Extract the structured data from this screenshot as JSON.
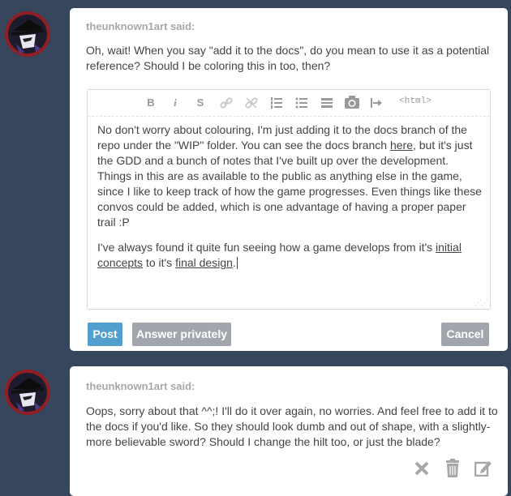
{
  "messages": [
    {
      "author": "theunknown1art said:",
      "text": "Oh, wait! When you say \"add it to the docs\", do you mean to use it as a potential reference? Should I be coloring this in too, then?"
    },
    {
      "author": "theunknown1art said:",
      "text": "Oops, sorry about that ^^;! I'll do it over again, no worries. And feel free to add it to the docs if you'd like. So they should look dumb and out of shape, with a slightly-more believable sword? Should I change the hilt too, or just the blade?"
    }
  ],
  "editor": {
    "toolbar": {
      "bold": "B",
      "italic": "i",
      "strike": "S",
      "html": "<html>"
    },
    "p1": {
      "before_link": "No don't worry about colouring, I'm just adding it to the docs branch of the repo under the \"WIP\" folder. You can see the docs branch ",
      "link": "here",
      "after_link": ", but it's just the GDD and a bunch of notes that I've built up over the development. Things in this are as available to the public as anything else in the game, since I like to keep track of how the game progresses. Even things like these convos could be added, which is one advantage of having a proper paper trail :P"
    },
    "p2": {
      "before_link1": "I've always found it quite fun seeing how a game develops from it's ",
      "link1": "initial concepts",
      "middle": " to it's ",
      "link2": "final design",
      "after_link2": "."
    }
  },
  "buttons": {
    "post": "Post",
    "answer_privately": "Answer privately",
    "cancel": "Cancel"
  },
  "icons": {
    "toolbar": [
      "bold-icon",
      "italic-icon",
      "strikethrough-icon",
      "link-icon",
      "unlink-icon",
      "numbered-list-icon",
      "bulleted-list-icon",
      "read-more-icon",
      "camera-icon",
      "indent-icon",
      "html-icon"
    ],
    "actions": [
      "delete-icon",
      "trash-icon",
      "edit-icon"
    ]
  },
  "colors": {
    "background": "#36465d",
    "post_button": "#529ecc",
    "secondary_button": "#a0a6ac",
    "author": "#a7a7a7",
    "avatar_ring": "#8f1f24"
  }
}
